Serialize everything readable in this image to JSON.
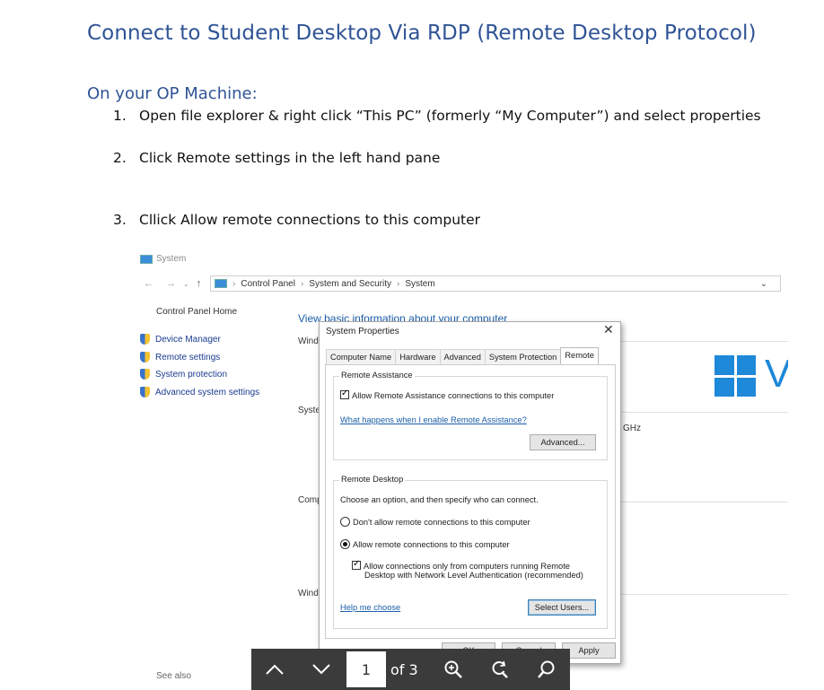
{
  "document": {
    "title": "Connect to Student Desktop Via RDP (Remote Desktop Protocol)",
    "subtitle": "On your OP Machine:",
    "steps": [
      {
        "num": "1.",
        "text": "Open file explorer & right click “This PC” (formerly “My Computer”) and select properties"
      },
      {
        "num": "2.",
        "text": "Click Remote settings in the left hand pane"
      },
      {
        "num": "3.",
        "text": "Cllick Allow remote connections to this computer"
      }
    ]
  },
  "screenshot": {
    "window_title": "System",
    "breadcrumb": [
      "Control Panel",
      "System and Security",
      "System"
    ],
    "sidebar": {
      "home": "Control Panel Home",
      "items": [
        "Device Manager",
        "Remote settings",
        "System protection",
        "Advanced system settings"
      ],
      "see_also": "See also"
    },
    "main_title": "View basic information about your computer",
    "fragments": {
      "wind1": "Wind",
      "syste": "Syste",
      "comp": "Comp",
      "wind2": "Wind",
      "ghz": "GHz",
      "v": "V"
    },
    "dialog": {
      "title": "System Properties",
      "tabs": [
        "Computer Name",
        "Hardware",
        "Advanced",
        "System Protection",
        "Remote"
      ],
      "active_tab": "Remote",
      "remote_assistance": {
        "label": "Remote Assistance",
        "allow_checkbox": "Allow Remote Assistance connections to this computer",
        "help_link": "What happens when I enable Remote Assistance?",
        "advanced_button": "Advanced..."
      },
      "remote_desktop": {
        "label": "Remote Desktop",
        "instructions": "Choose an option, and then specify who can connect.",
        "option_dont_allow": "Don't allow remote connections to this computer",
        "option_allow": "Allow remote connections to this computer",
        "nla_line1": "Allow connections only from computers running Remote",
        "nla_line2": "Desktop with Network Level Authentication (recommended)",
        "help_link": "Help me choose",
        "select_users_button": "Select Users..."
      },
      "ok": "OK",
      "cancel": "Cancel",
      "apply": "Apply"
    }
  },
  "toolbar": {
    "current_page": "1",
    "page_count": "of 3"
  },
  "colors": {
    "heading": "#2f5496",
    "toolbar_bg": "#3b3b3b",
    "link": "#1b5fa8"
  }
}
